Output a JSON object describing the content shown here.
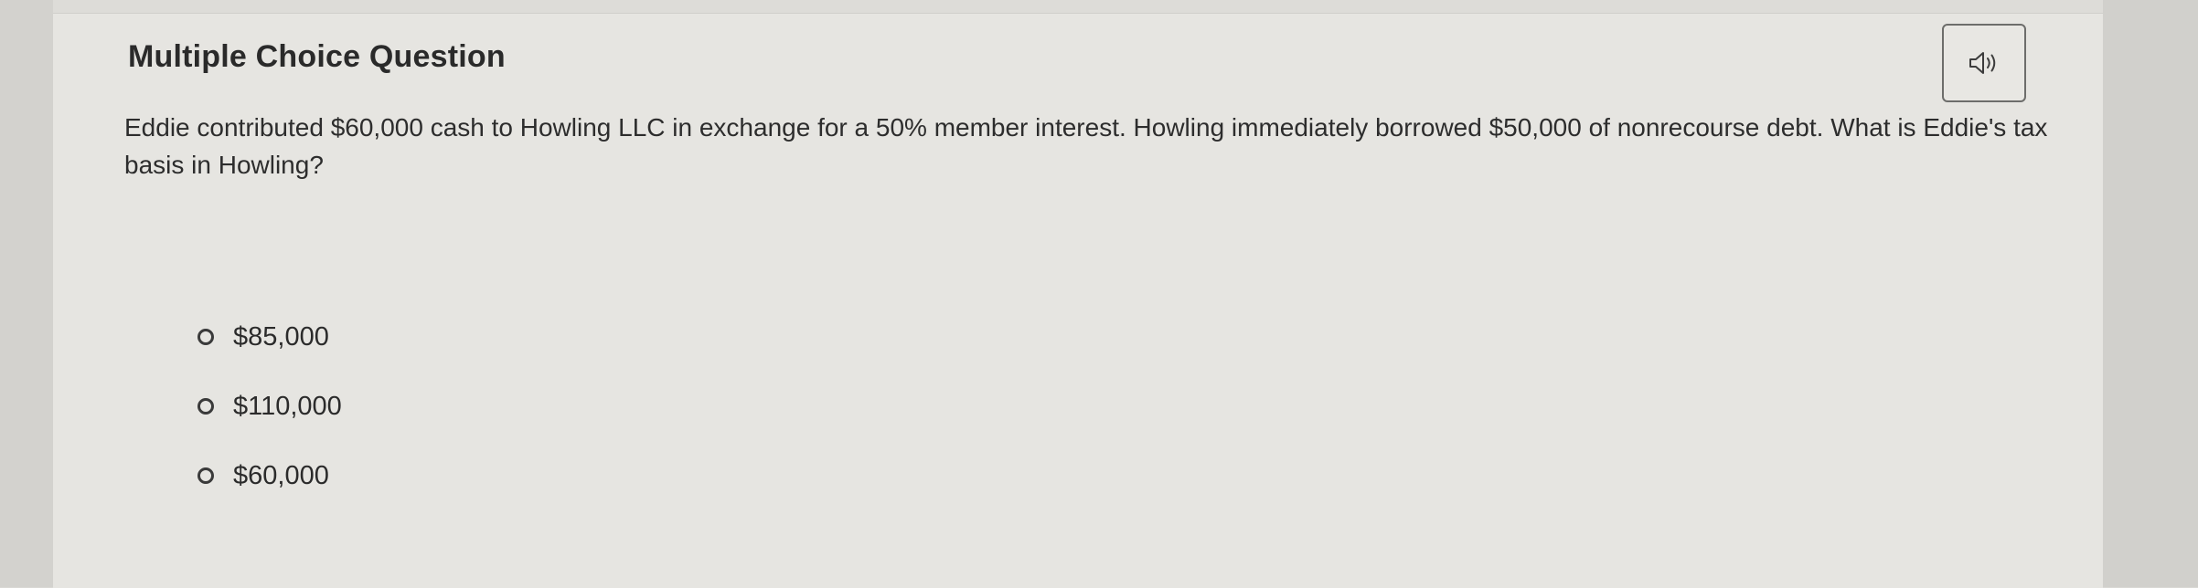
{
  "question_card": {
    "title": "Multiple Choice Question",
    "audio_icon": "speaker-icon",
    "prompt": "Eddie contributed $60,000 cash to Howling LLC in exchange for a 50% member interest. Howling immediately borrowed $50,000 of nonrecourse debt. What is Eddie's tax basis in Howling?",
    "options": [
      {
        "label": "$85,000",
        "selected": false
      },
      {
        "label": "$110,000",
        "selected": false
      },
      {
        "label": "$60,000",
        "selected": false
      }
    ]
  },
  "colors": {
    "background": "#d9d8d4",
    "card": "#e6e5e1",
    "text": "#2d2d2d"
  }
}
